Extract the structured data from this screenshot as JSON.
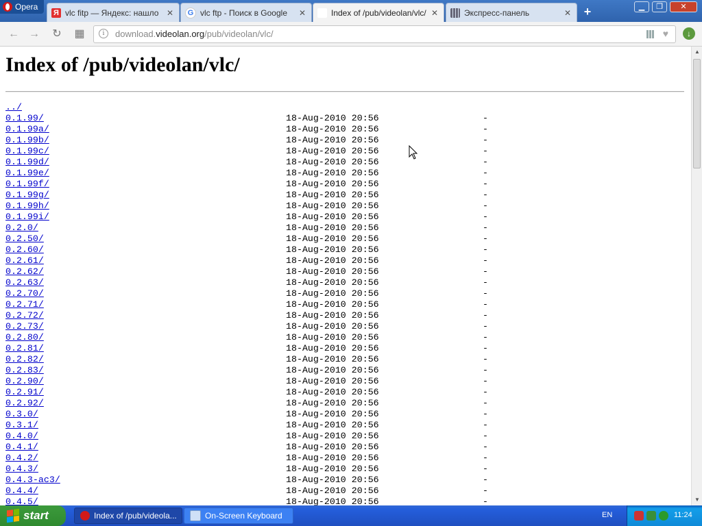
{
  "browser": {
    "menu_label": "Opera",
    "tabs": [
      {
        "title": "vlc fitp — Яндекс: нашло",
        "favicon": "yandex-icon",
        "active": false
      },
      {
        "title": "vlc ftp - Поиск в Google",
        "favicon": "google-icon",
        "active": false
      },
      {
        "title": "Index of /pub/videolan/vlc/",
        "favicon": "page-icon",
        "active": true
      },
      {
        "title": "Экспресс-панель",
        "favicon": "speed-dial-icon",
        "active": false
      }
    ],
    "url_prefix": "download.",
    "url_host": "videolan.org",
    "url_path": "/pub/videolan/vlc/"
  },
  "page": {
    "title": "Index of /pub/videolan/vlc/",
    "parent_link": "../",
    "entries": [
      {
        "name": "0.1.99/",
        "date": "18-Aug-2010 20:56",
        "size": "-"
      },
      {
        "name": "0.1.99a/",
        "date": "18-Aug-2010 20:56",
        "size": "-"
      },
      {
        "name": "0.1.99b/",
        "date": "18-Aug-2010 20:56",
        "size": "-"
      },
      {
        "name": "0.1.99c/",
        "date": "18-Aug-2010 20:56",
        "size": "-"
      },
      {
        "name": "0.1.99d/",
        "date": "18-Aug-2010 20:56",
        "size": "-"
      },
      {
        "name": "0.1.99e/",
        "date": "18-Aug-2010 20:56",
        "size": "-"
      },
      {
        "name": "0.1.99f/",
        "date": "18-Aug-2010 20:56",
        "size": "-"
      },
      {
        "name": "0.1.99g/",
        "date": "18-Aug-2010 20:56",
        "size": "-"
      },
      {
        "name": "0.1.99h/",
        "date": "18-Aug-2010 20:56",
        "size": "-"
      },
      {
        "name": "0.1.99i/",
        "date": "18-Aug-2010 20:56",
        "size": "-"
      },
      {
        "name": "0.2.0/",
        "date": "18-Aug-2010 20:56",
        "size": "-"
      },
      {
        "name": "0.2.50/",
        "date": "18-Aug-2010 20:56",
        "size": "-"
      },
      {
        "name": "0.2.60/",
        "date": "18-Aug-2010 20:56",
        "size": "-"
      },
      {
        "name": "0.2.61/",
        "date": "18-Aug-2010 20:56",
        "size": "-"
      },
      {
        "name": "0.2.62/",
        "date": "18-Aug-2010 20:56",
        "size": "-"
      },
      {
        "name": "0.2.63/",
        "date": "18-Aug-2010 20:56",
        "size": "-"
      },
      {
        "name": "0.2.70/",
        "date": "18-Aug-2010 20:56",
        "size": "-"
      },
      {
        "name": "0.2.71/",
        "date": "18-Aug-2010 20:56",
        "size": "-"
      },
      {
        "name": "0.2.72/",
        "date": "18-Aug-2010 20:56",
        "size": "-"
      },
      {
        "name": "0.2.73/",
        "date": "18-Aug-2010 20:56",
        "size": "-"
      },
      {
        "name": "0.2.80/",
        "date": "18-Aug-2010 20:56",
        "size": "-"
      },
      {
        "name": "0.2.81/",
        "date": "18-Aug-2010 20:56",
        "size": "-"
      },
      {
        "name": "0.2.82/",
        "date": "18-Aug-2010 20:56",
        "size": "-"
      },
      {
        "name": "0.2.83/",
        "date": "18-Aug-2010 20:56",
        "size": "-"
      },
      {
        "name": "0.2.90/",
        "date": "18-Aug-2010 20:56",
        "size": "-"
      },
      {
        "name": "0.2.91/",
        "date": "18-Aug-2010 20:56",
        "size": "-"
      },
      {
        "name": "0.2.92/",
        "date": "18-Aug-2010 20:56",
        "size": "-"
      },
      {
        "name": "0.3.0/",
        "date": "18-Aug-2010 20:56",
        "size": "-"
      },
      {
        "name": "0.3.1/",
        "date": "18-Aug-2010 20:56",
        "size": "-"
      },
      {
        "name": "0.4.0/",
        "date": "18-Aug-2010 20:56",
        "size": "-"
      },
      {
        "name": "0.4.1/",
        "date": "18-Aug-2010 20:56",
        "size": "-"
      },
      {
        "name": "0.4.2/",
        "date": "18-Aug-2010 20:56",
        "size": "-"
      },
      {
        "name": "0.4.3/",
        "date": "18-Aug-2010 20:56",
        "size": "-"
      },
      {
        "name": "0.4.3-ac3/",
        "date": "18-Aug-2010 20:56",
        "size": "-"
      },
      {
        "name": "0.4.4/",
        "date": "18-Aug-2010 20:56",
        "size": "-"
      },
      {
        "name": "0.4.5/",
        "date": "18-Aug-2010 20:56",
        "size": "-"
      }
    ]
  },
  "taskbar": {
    "start_label": "start",
    "tasks": [
      {
        "label": "Index of /pub/videola...",
        "icon": "opera-icon",
        "active": true
      },
      {
        "label": "On-Screen Keyboard",
        "icon": "keyboard-icon",
        "active": false
      }
    ],
    "language": "EN",
    "clock": "11:24"
  },
  "colors": {
    "link": "#0000cc",
    "taskbar_blue": "#245edb",
    "start_green": "#2f8a2f",
    "tray_blue": "#0f8ad8"
  }
}
